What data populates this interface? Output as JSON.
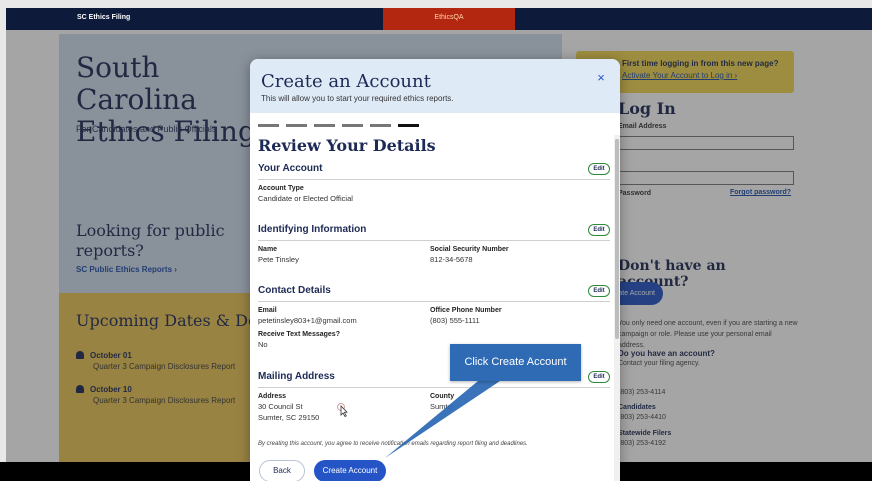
{
  "header": {
    "site_name": "SC Ethics Filing",
    "env_tag": "EthicsQA"
  },
  "hero": {
    "title": "South Carolina Ethics Filing",
    "subtitle": "For Candidates and Public Officials",
    "reports_title": "Looking for public reports?",
    "reports_link": "SC Public Ethics Reports  ›"
  },
  "dates": {
    "title": "Upcoming Dates & Deadlines",
    "items": [
      {
        "date": "October 01",
        "desc": "Quarter 3 Campaign Disclosures Report"
      },
      {
        "date": "October 10",
        "desc": "Quarter 3 Campaign Disclosures Report"
      }
    ]
  },
  "login": {
    "notice_line1": "First time logging in from this new page?",
    "notice_line2": "Activate Your Account to Log in ›",
    "heading": "Log In",
    "email_label": "Email Address",
    "password_label": "Password",
    "forgot": "Forgot password?",
    "have_account": "Don't have an account?",
    "create_label": "Create Account",
    "info": "You only need one account, even if you are starting a new campaign or role. Please use your personal email address.",
    "q_have": "Do you have an account?",
    "q_filing": "Contact your filing agency.",
    "phone1": "(803) 253-4114",
    "phone2_label": "Candidates",
    "phone2": "(803) 253-4410",
    "phone3_label": "Statewide Filers",
    "phone3": "(803) 253-4192"
  },
  "modal": {
    "title": "Create an Account",
    "subtitle": "This will allow you to start your required ethics reports.",
    "close": "×",
    "steps_total": 6,
    "steps_current": 6,
    "review_title": "Review Your Details",
    "edit_label": "Edit",
    "your_account": {
      "heading": "Your Account",
      "type_label": "Account Type",
      "type_value": "Candidate or Elected Official"
    },
    "identifying": {
      "heading": "Identifying Information",
      "name_label": "Name",
      "name_value": "Pete Tinsley",
      "ssn_label": "Social Security Number",
      "ssn_value": "812-34-5678"
    },
    "contact": {
      "heading": "Contact Details",
      "email_label": "Email",
      "email_value": "petetinsley803+1@gmail.com",
      "phone_label": "Office Phone Number",
      "phone_value": "(803) 555-1111",
      "text_label": "Receive Text Messages?",
      "text_value": "No"
    },
    "mailing": {
      "heading": "Mailing Address",
      "address_label": "Address",
      "address_line1": "30 Council St",
      "address_line2": "Sumter, SC 29150",
      "county_label": "County",
      "county_value": "Sumter"
    },
    "consent": "By creating this account, you agree to receive notification emails regarding report filing and deadlines.",
    "back": "Back",
    "create": "Create Account"
  },
  "callout": {
    "text": "Click Create Account"
  },
  "colors": {
    "navy": "#0d1a3a",
    "primary_blue": "#2454c6",
    "callout_blue": "#2f6bb5",
    "env_red": "#b3260f",
    "edit_green": "#2c8a3a",
    "notice_yellow": "#f2d652"
  }
}
